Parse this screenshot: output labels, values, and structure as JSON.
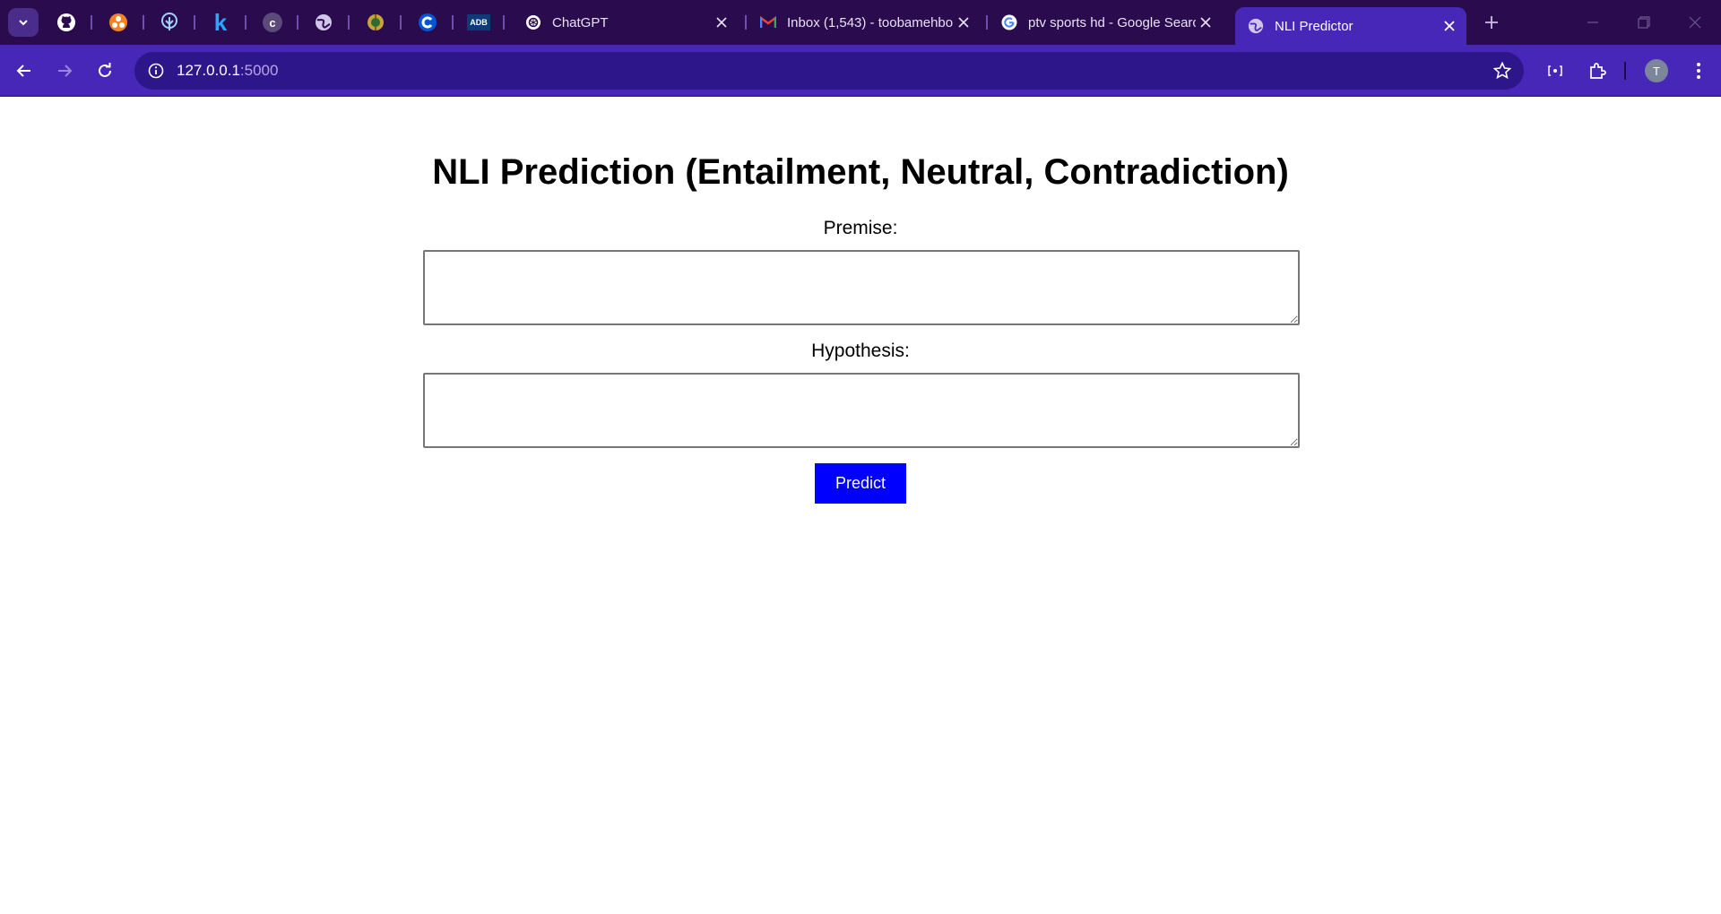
{
  "browser": {
    "tabs": [
      {
        "title": "ChatGPT",
        "icon": "chatgpt-icon"
      },
      {
        "title": "Inbox (1,543) - toobamehbo",
        "icon": "gmail-icon"
      },
      {
        "title": "ptv sports hd - Google Search",
        "icon": "google-icon"
      },
      {
        "title": "NLI Predictor",
        "icon": "globe-icon",
        "active": true
      }
    ],
    "pinned_icons": [
      "github-icon",
      "orange-app-icon",
      "tree-icon",
      "k-icon",
      "c-icon",
      "globe-icon",
      "emblem-icon",
      "coursera-icon",
      "adb-icon"
    ],
    "adb_label": "ADB",
    "k_label": "k",
    "c_label": "c",
    "url_host": "127.0.0.1",
    "url_port": ":5000",
    "profile_initial": "T",
    "accent_color": "#4627b7"
  },
  "page": {
    "heading": "NLI Prediction (Entailment, Neutral, Contradiction)",
    "premise_label": "Premise:",
    "premise_value": "",
    "hypothesis_label": "Hypothesis:",
    "hypothesis_value": "",
    "predict_label": "Predict",
    "predict_color": "#0000ff"
  }
}
